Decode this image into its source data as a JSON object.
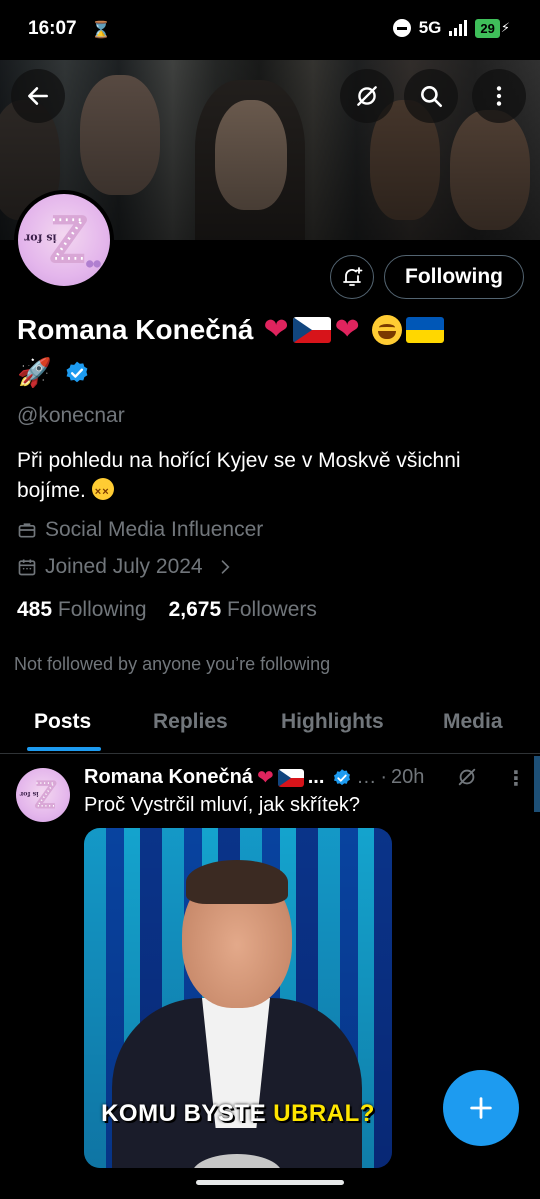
{
  "status_bar": {
    "time": "16:07",
    "network": "5G",
    "battery": "29"
  },
  "profile": {
    "name": "Romana Konečná",
    "handle": "@konecnar",
    "bio": "Při pohledu na hořící Kyjev se v Moskvě všichni bojíme.",
    "category": "Social Media Influencer",
    "joined": "Joined July 2024",
    "following_count": "485",
    "following_label": "Following",
    "followers_count": "2,675",
    "followers_label": "Followers",
    "not_followed_text": "Not followed by anyone you’re following",
    "avatar_text": "is for"
  },
  "actions": {
    "follow_button_label": "Following"
  },
  "tabs": [
    {
      "label": "Posts",
      "active": true
    },
    {
      "label": "Replies",
      "active": false
    },
    {
      "label": "Highlights",
      "active": false
    },
    {
      "label": "Media",
      "active": false
    }
  ],
  "post": {
    "author_name": "Romana Konečná",
    "truncation": "...",
    "handle_truncated": "…",
    "separator": "·",
    "time": "20h",
    "text": "Proč Vystrčil mluví, jak skřítek?",
    "media_caption_part1": "KOMU BYSTE",
    "media_caption_part2": "UBRAL?"
  },
  "icons": {
    "back": "arrow-left-icon",
    "grok": "grok-icon",
    "search": "search-icon",
    "more": "more-vertical-icon",
    "bell": "bell-plus-icon",
    "verified": "verified-badge-icon",
    "category": "briefcase-icon",
    "calendar": "calendar-icon",
    "compose": "plus-icon"
  },
  "colors": {
    "accent": "#1d9bf0",
    "muted": "#71767b",
    "background": "#000000"
  }
}
